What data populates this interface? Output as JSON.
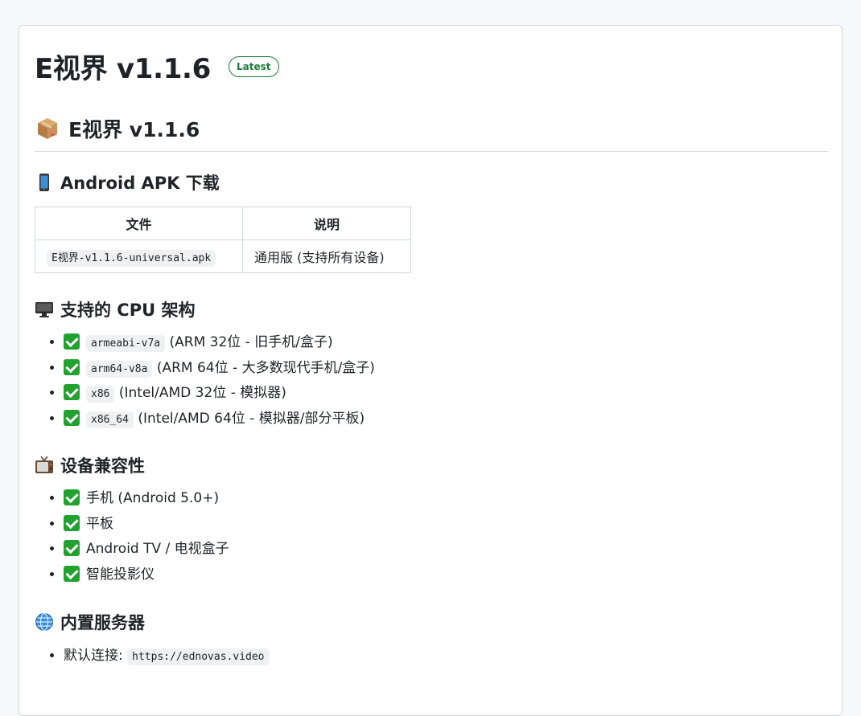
{
  "release": {
    "title": "E视界 v1.1.6",
    "badge": "Latest"
  },
  "heading": "E视界 v1.1.6",
  "apk_section": {
    "title": "Android APK 下载",
    "table": {
      "headers": [
        "文件",
        "说明"
      ],
      "rows": [
        {
          "file": "E视界-v1.1.6-universal.apk",
          "desc": "通用版 (支持所有设备)"
        }
      ]
    }
  },
  "cpu_section": {
    "title": "支持的 CPU 架构",
    "items": [
      {
        "code": "armeabi-v7a",
        "text": "(ARM 32位 - 旧手机/盒子)"
      },
      {
        "code": "arm64-v8a",
        "text": "(ARM 64位 - 大多数现代手机/盒子)"
      },
      {
        "code": "x86",
        "text": "(Intel/AMD 32位 - 模拟器)"
      },
      {
        "code": "x86_64",
        "text": "(Intel/AMD 64位 - 模拟器/部分平板)"
      }
    ]
  },
  "compat_section": {
    "title": "设备兼容性",
    "items": [
      "手机 (Android 5.0+)",
      "平板",
      "Android TV / 电视盒子",
      "智能投影仪"
    ]
  },
  "server_section": {
    "title": "内置服务器",
    "items": [
      {
        "label": "默认连接: ",
        "code": "https://ednovas.video"
      }
    ]
  },
  "icons": {
    "heading": "package-icon",
    "apk": "mobile-phone-icon",
    "cpu": "desktop-computer-icon",
    "compat": "television-icon",
    "server": "globe-icon",
    "check": "check-mark-icon"
  },
  "colors": {
    "badge": "#1a7f37",
    "check": "#21a12e"
  }
}
